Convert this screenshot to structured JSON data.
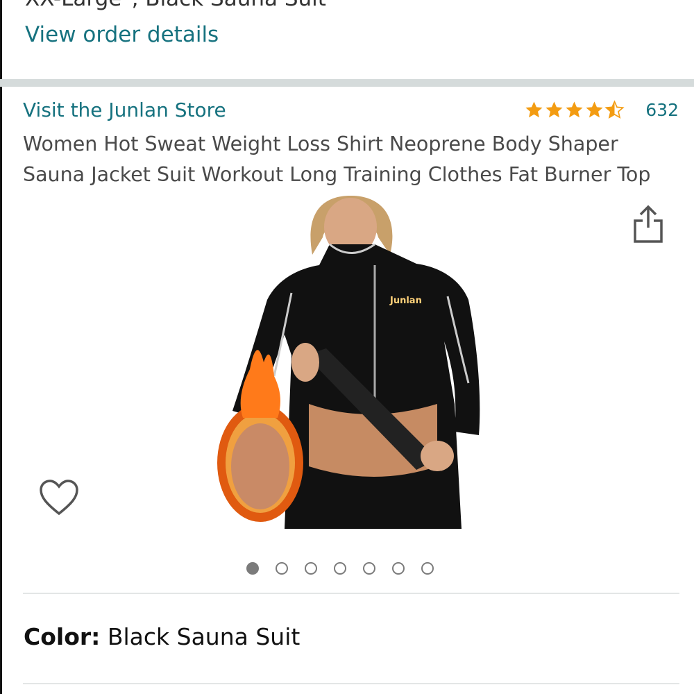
{
  "previous_order": {
    "partial_text": "XX-Large\", Black Sauna Suit",
    "view_details_label": "View order details"
  },
  "product": {
    "store_link": "Visit the Junlan Store",
    "rating": {
      "stars": 4.5,
      "max": 5,
      "count": "632",
      "star_color": "#f39c12"
    },
    "title": "Women Hot Sweat Weight Loss Shirt Neoprene Body Shaper Sauna Jacket Suit Workout Long Training Clothes Fat Burner Top",
    "image": {
      "brand_logo_text": "Junlan",
      "total_images": 7,
      "current_index": 1
    },
    "color": {
      "label": "Color:",
      "value": "Black Sauna Suit"
    }
  },
  "icons": {
    "share": "share-icon",
    "wishlist": "heart-icon",
    "star": "star-icon"
  },
  "colors": {
    "link": "#16727f",
    "divider": "#d5dbdb"
  }
}
